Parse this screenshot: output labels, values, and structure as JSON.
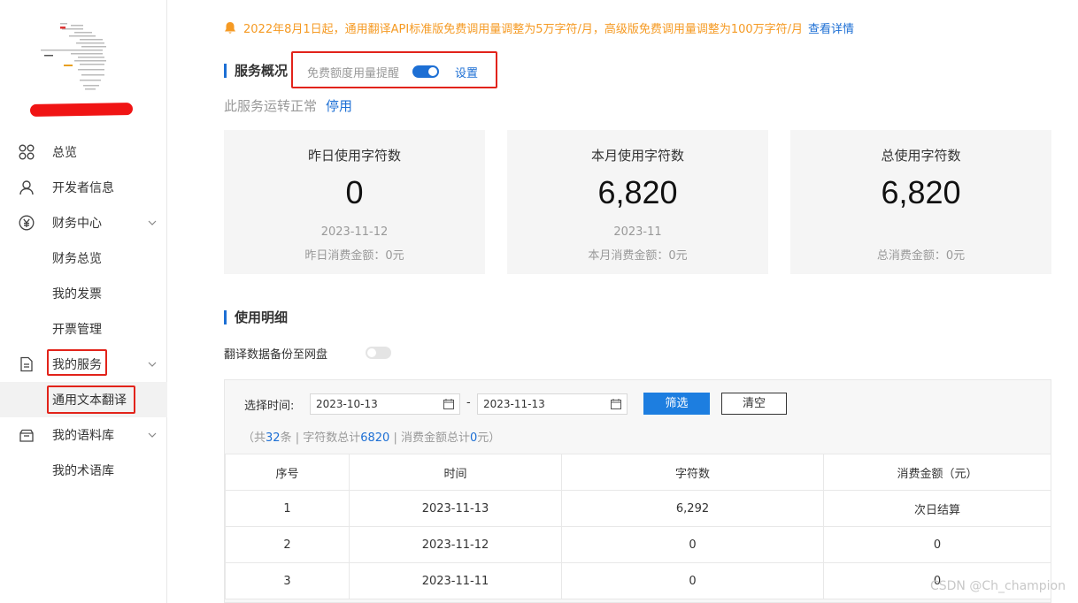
{
  "sidebar": {
    "items": [
      {
        "label": "总览",
        "icon": "grid-icon"
      },
      {
        "label": "开发者信息",
        "icon": "user-icon"
      },
      {
        "label": "财务中心",
        "icon": "yen-icon"
      },
      {
        "label": "财务总览"
      },
      {
        "label": "我的发票"
      },
      {
        "label": "开票管理"
      },
      {
        "label": "我的服务",
        "icon": "document-icon"
      },
      {
        "label": "通用文本翻译"
      },
      {
        "label": "我的语料库",
        "icon": "inbox-icon"
      },
      {
        "label": "我的术语库"
      }
    ]
  },
  "notice": {
    "text": "2022年8月1日起，通用翻译API标准版免费调用量调整为5万字符/月，高级版免费调用量调整为100万字符/月",
    "link": "查看详情"
  },
  "overview": {
    "title": "服务概况",
    "quota_label": "免费额度用量提醒",
    "quota_enabled": true,
    "quota_setting": "设置",
    "status_text": "此服务运转正常",
    "stop_link": "停用"
  },
  "cards": [
    {
      "title": "昨日使用字符数",
      "value": "0",
      "date": "2023-11-12",
      "fee": "昨日消费金额：0元"
    },
    {
      "title": "本月使用字符数",
      "value": "6,820",
      "date": "2023-11",
      "fee": "本月消费金额：0元"
    },
    {
      "title": "总使用字符数",
      "value": "6,820",
      "date": "",
      "fee": "总消费金额：0元"
    }
  ],
  "details": {
    "title": "使用明细",
    "backup_label": "翻译数据备份至网盘",
    "backup_enabled": false,
    "filter_label": "选择时间:",
    "start_date": "2023-10-13",
    "end_date": "2023-11-13",
    "dash": "-",
    "filter_button": "筛选",
    "clear_button": "清空",
    "summary": {
      "p1": "（共",
      "count": "32",
      "p2": "条 | 字符数总计",
      "chars": "6820",
      "p3": " | 消费金额总计",
      "amount": "0",
      "p4": "元）"
    },
    "columns": [
      "序号",
      "时间",
      "字符数",
      "消费金额（元）"
    ],
    "rows": [
      [
        "1",
        "2023-11-13",
        "6,292",
        "次日结算"
      ],
      [
        "2",
        "2023-11-12",
        "0",
        "0"
      ],
      [
        "3",
        "2023-11-11",
        "0",
        "0"
      ]
    ]
  },
  "watermark": "CSDN @Ch_champion",
  "colors": {
    "accent": "#1d6fd4",
    "warning": "#f59a23",
    "highlight_border": "#e2231a",
    "button": "#1d7ee0"
  }
}
